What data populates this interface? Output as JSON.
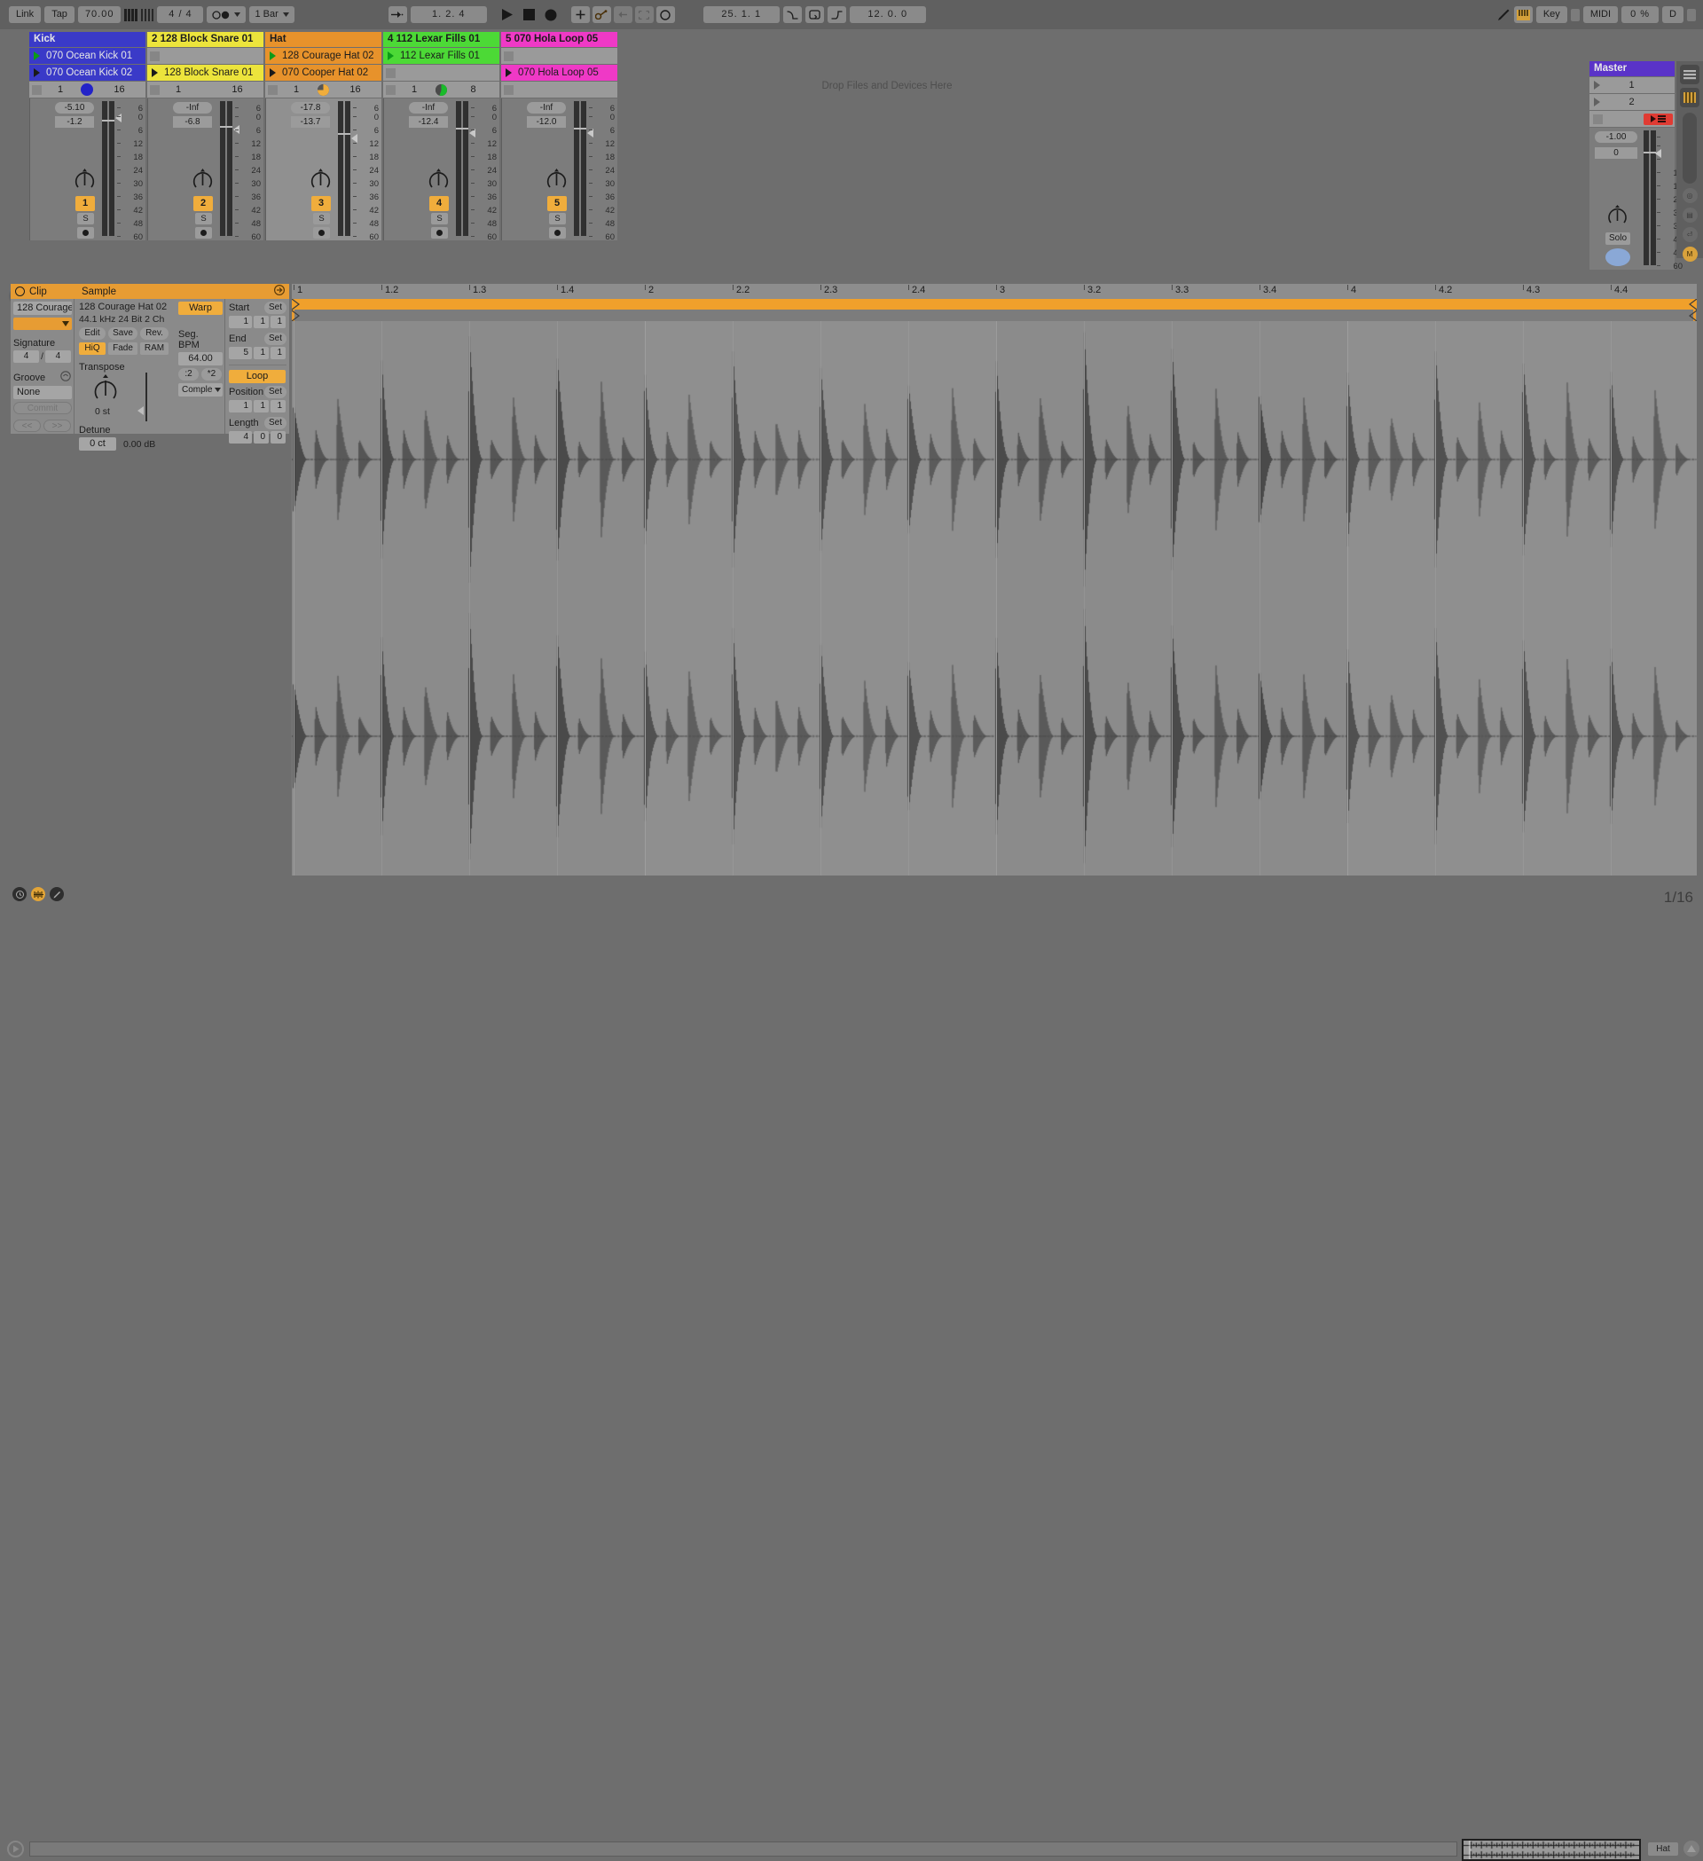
{
  "topbar": {
    "link": "Link",
    "tap": "Tap",
    "tempo": "70.00",
    "metronome_icon": "metronome-icon",
    "signature": "4 / 4",
    "follow_icon": "follow-icon",
    "quantization": "1 Bar",
    "punch_in_icon": "punch-in-icon",
    "arrangement_position": "1. 2. 4",
    "play_icon": "play-icon",
    "stop_icon": "stop-icon",
    "record_icon": "record-icon",
    "draw_icon": "draw-mode-icon",
    "automation_icon": "automation-arm-icon",
    "back_to_arrangement_icon": "back-to-arrangement-icon",
    "loop_icon": "loop-selector-icon",
    "midi_arm_icon": "midi-arm-icon",
    "loop_start": "25. 1. 1",
    "fade_in_icon": "fade-in-icon",
    "loop_toggle_icon": "loop-toggle-icon",
    "fade_out_icon": "fade-out-icon",
    "loop_length": "12. 0. 0",
    "pencil_icon": "pencil-icon",
    "keyboard_icon": "computer-midi-keyboard-icon",
    "key_label": "Key",
    "midi_label": "MIDI",
    "cpu_load": "0 %",
    "disk_label": "D"
  },
  "session": {
    "tracks": [
      {
        "name": "Kick",
        "title_color": "#3a3ac8",
        "clip_color": "#3a3ac8",
        "text_color": "#e6e6e6",
        "slots": [
          {
            "label": "070 Ocean Kick 01",
            "state": "playing"
          },
          {
            "label": "070 Ocean Kick 02",
            "state": "stopped"
          }
        ],
        "stop_row": {
          "left_num": "1",
          "right_num": "16",
          "dial": "blue"
        },
        "mixer": {
          "volume": "-5.10",
          "pan": "-1.2",
          "number": "1",
          "solo": "S",
          "selected": false
        }
      },
      {
        "name": "2 128 Block Snare 01",
        "title_color": "#ece43c",
        "clip_color": "#ece43c",
        "text_color": "#1c1c1c",
        "slots": [
          {
            "label": "",
            "state": "empty"
          },
          {
            "label": "128 Block Snare 01",
            "state": "stopped"
          }
        ],
        "stop_row": {
          "left_num": "1",
          "right_num": "16",
          "dial": "none"
        },
        "mixer": {
          "volume": "-Inf",
          "pan": "-6.8",
          "number": "2",
          "solo": "S",
          "selected": false
        }
      },
      {
        "name": "Hat",
        "title_color": "#e7922b",
        "clip_color": "#e7922b",
        "text_color": "#1c1c1c",
        "slots": [
          {
            "label": "128 Courage Hat 02",
            "state": "playing"
          },
          {
            "label": "070 Cooper Hat 02",
            "state": "stopped"
          }
        ],
        "stop_row": {
          "left_num": "1",
          "right_num": "16",
          "dial": "orange"
        },
        "mixer": {
          "volume": "-17.8",
          "pan": "-13.7",
          "number": "3",
          "solo": "S",
          "selected": true
        }
      },
      {
        "name": "4 112 Lexar Fills 01",
        "title_color": "#4cd936",
        "clip_color": "#4cd936",
        "text_color": "#1c1c1c",
        "slots": [
          {
            "label": "112 Lexar Fills 01",
            "state": "playing"
          },
          {
            "label": "",
            "state": "empty"
          }
        ],
        "stop_row": {
          "left_num": "1",
          "right_num": "8",
          "dial": "green"
        },
        "mixer": {
          "volume": "-Inf",
          "pan": "-12.4",
          "number": "4",
          "solo": "S",
          "selected": false
        }
      },
      {
        "name": "5 070 Hola Loop 05",
        "title_color": "#ef39c6",
        "clip_color": "#ef39c6",
        "text_color": "#1c1c1c",
        "slots": [
          {
            "label": "",
            "state": "empty"
          },
          {
            "label": "070 Hola Loop 05",
            "state": "stopped"
          }
        ],
        "stop_row": {
          "left_num": "",
          "right_num": "",
          "dial": "none"
        },
        "mixer": {
          "volume": "-Inf",
          "pan": "-12.0",
          "number": "5",
          "solo": "S",
          "selected": false
        }
      }
    ],
    "drop_hint": "Drop Files and Devices Here",
    "meter_scale": [
      "6",
      "0",
      "6",
      "12",
      "18",
      "24",
      "30",
      "36",
      "42",
      "48",
      "60"
    ],
    "master": {
      "name": "Master",
      "sends": [
        "1",
        "2"
      ],
      "volume": "-1.00",
      "pan": "0",
      "solo_label": "Solo",
      "record_icon": "session-record-icon",
      "rail": {
        "list_icon": "track-list-icon",
        "keys_icon": "piano-keys-icon",
        "cue_icon": "cue-volume-icon",
        "io_icon": "io-icon",
        "return_icon": "return-icon",
        "master_icon": "master-icon"
      }
    }
  },
  "clip_panel": {
    "title": "Clip",
    "clip_name": "128 Courage",
    "color_swatch": "#e79c33",
    "signature_label": "Signature",
    "signature_num": "4",
    "signature_den": "4",
    "groove_label": "Groove",
    "groove_value": "None",
    "commit_label": "Commit",
    "prev_label": "<<",
    "next_label": ">>"
  },
  "sample_panel": {
    "title": "Sample",
    "file_name": "128 Courage Hat 02",
    "file_info": "44.1 kHz 24 Bit 2 Ch",
    "edit_label": "Edit",
    "save_label": "Save",
    "rev_label": "Rev.",
    "hiq_label": "HiQ",
    "fade_label": "Fade",
    "ram_label": "RAM",
    "transpose_label": "Transpose",
    "transpose_value": "0 st",
    "detune_label": "Detune",
    "detune_value": "0 ct",
    "gain_value": "0.00 dB"
  },
  "warp_panel": {
    "warp_label": "Warp",
    "seg_bpm_label": "Seg. BPM",
    "seg_bpm_value": "64.00",
    "half_label": ":2",
    "double_label": "*2",
    "mode_label": "Comple",
    "start_label": "Start",
    "start_set": "Set",
    "start_bar": "1",
    "start_beat": "1",
    "start_sixteenth": "1",
    "end_label": "End",
    "end_set": "Set",
    "end_bar": "5",
    "end_beat": "1",
    "end_sixteenth": "1",
    "loop_label": "Loop",
    "position_label": "Position",
    "position_set": "Set",
    "position_bar": "1",
    "position_beat": "1",
    "position_sixteenth": "1",
    "length_label": "Length",
    "length_set": "Set",
    "length_bars": "4",
    "length_beats": "0",
    "length_sixteenths": "0",
    "unfold_icon": "unfold-device-icon"
  },
  "waveform": {
    "ruler_labels": [
      "1",
      "1.2",
      "1.3",
      "1.4",
      "2",
      "2.2",
      "2.3",
      "2.4",
      "3",
      "3.2",
      "3.3",
      "3.4",
      "4",
      "4.2",
      "4.3",
      "4.4"
    ],
    "zoom_grid": "1/16"
  },
  "bottom": {
    "clock_icon": "clock-icon",
    "groove_pool_icon": "groove-pool-icon",
    "pencil_icon": "pencil-icon",
    "status_message": "",
    "overview_track": "Hat",
    "overview_icon": "crossfader-icon",
    "play_icon": "play-icon"
  }
}
